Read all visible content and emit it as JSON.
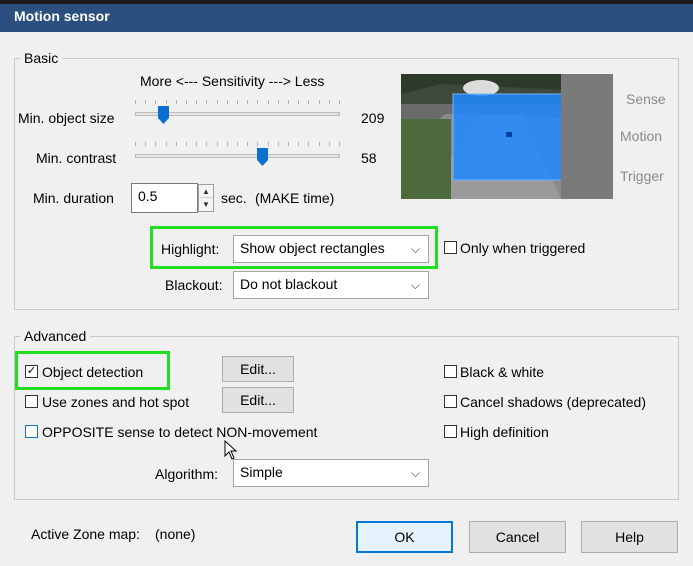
{
  "window": {
    "title": "Motion sensor"
  },
  "basic": {
    "group_label": "Basic",
    "sensitivity_label": "More <--- Sensitivity ---> Less",
    "min_object_size": {
      "label": "Min. object size",
      "value": "209",
      "level": 0.12
    },
    "min_contrast": {
      "label": "Min. contrast",
      "value": "58",
      "level": 0.63
    },
    "min_duration": {
      "label": "Min. duration",
      "value": "0.5",
      "unit": "sec.",
      "note": "(MAKE time)"
    },
    "highlight": {
      "label": "Highlight:",
      "selected": "Show object rectangles"
    },
    "only_when_triggered": {
      "label": "Only when triggered",
      "checked": false
    },
    "blackout": {
      "label": "Blackout:",
      "selected": "Do not blackout"
    },
    "preview_side_labels": [
      "Sense",
      "Motion",
      "Trigger"
    ]
  },
  "advanced": {
    "group_label": "Advanced",
    "object_detection": {
      "label": "Object detection",
      "checked": true
    },
    "use_zones": {
      "label": "Use zones and hot spot",
      "checked": false
    },
    "opposite_sense": {
      "label": "OPPOSITE sense to detect NON-movement",
      "checked": false
    },
    "edit_label_1": "Edit...",
    "edit_label_2": "Edit...",
    "black_white": {
      "label": "Black & white",
      "checked": false
    },
    "cancel_shadows": {
      "label": "Cancel shadows (deprecated)",
      "checked": false
    },
    "high_definition": {
      "label": "High definition",
      "checked": false
    },
    "algorithm": {
      "label": "Algorithm:",
      "selected": "Simple"
    }
  },
  "footer": {
    "active_zone_label": "Active Zone map:",
    "active_zone_value": "(none)",
    "ok_label": "OK",
    "cancel_label": "Cancel",
    "help_label": "Help"
  },
  "colors": {
    "titlebar": "#2b4f7e",
    "highlight_green": "#22dd22",
    "accent_blue": "#0078d7",
    "slider_thumb": "#0a70d0",
    "overlay_blue": "#1e88ff"
  }
}
